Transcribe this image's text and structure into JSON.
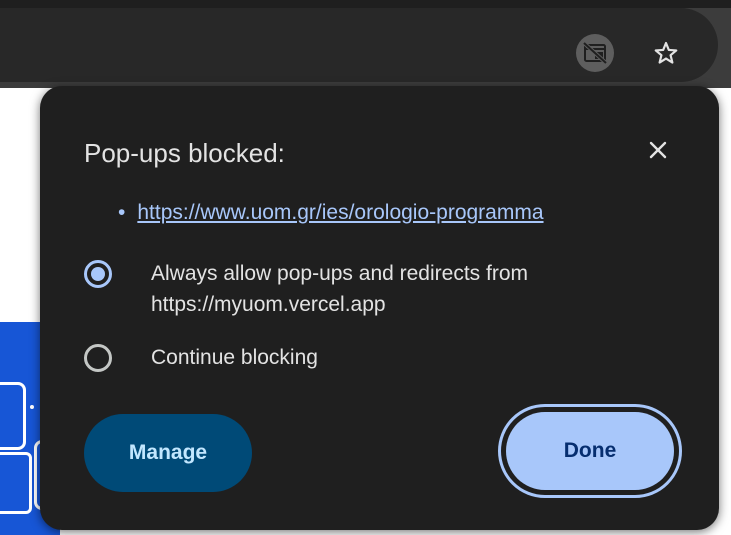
{
  "bubble": {
    "title": "Pop-ups blocked:",
    "blocked_items": [
      "https://www.uom.gr/ies/orologio-programma"
    ],
    "options": [
      {
        "label": "Always allow pop-ups and redirects from https://myuom.vercel.app",
        "selected": true
      },
      {
        "label": "Continue blocking",
        "selected": false
      }
    ],
    "manage_label": "Manage",
    "done_label": "Done"
  },
  "colors": {
    "bubble_bg": "#1f1f1f",
    "link": "#a8c7fa",
    "text": "#e3e3e3",
    "manage_bg": "#004a77",
    "done_bg": "#a8c7fa",
    "page_blue": "#1756d6"
  },
  "icons": {
    "toolbar_indicator": "popup-blocked-icon",
    "toolbar_bookmark": "bookmark-star-icon",
    "close": "close-icon"
  }
}
